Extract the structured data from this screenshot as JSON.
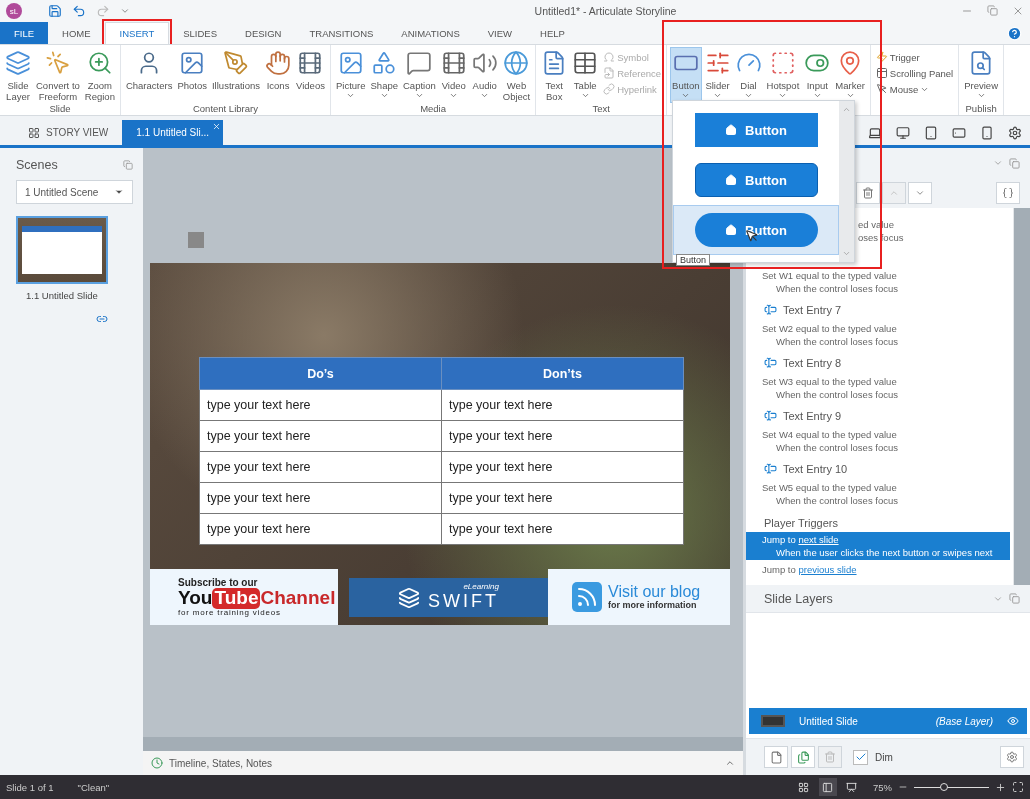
{
  "app": {
    "badge": "sL",
    "title": "Untitled1* - Articulate Storyline"
  },
  "menu_tabs": [
    {
      "label": "FILE",
      "kind": "file",
      "selected": false,
      "highlighted": false
    },
    {
      "label": "HOME",
      "kind": "tab",
      "selected": false,
      "highlighted": false
    },
    {
      "label": "INSERT",
      "kind": "tab",
      "selected": true,
      "highlighted": true
    },
    {
      "label": "SLIDES",
      "kind": "tab",
      "selected": false,
      "highlighted": false
    },
    {
      "label": "DESIGN",
      "kind": "tab",
      "selected": false,
      "highlighted": false
    },
    {
      "label": "TRANSITIONS",
      "kind": "tab",
      "selected": false,
      "highlighted": false
    },
    {
      "label": "ANIMATIONS",
      "kind": "tab",
      "selected": false,
      "highlighted": false
    },
    {
      "label": "VIEW",
      "kind": "tab",
      "selected": false,
      "highlighted": false
    },
    {
      "label": "HELP",
      "kind": "tab",
      "selected": false,
      "highlighted": false
    }
  ],
  "ribbon": [
    {
      "label": "Slide",
      "items": [
        {
          "lines": [
            "Slide",
            "Layer"
          ],
          "kind": "large",
          "dropdown": false,
          "selected": false,
          "disabled": false
        },
        {
          "lines": [
            "Convert to",
            "Freeform"
          ],
          "kind": "large",
          "dropdown": false,
          "selected": false,
          "disabled": false
        },
        {
          "lines": [
            "Zoom",
            "Region"
          ],
          "kind": "large",
          "dropdown": false,
          "selected": false,
          "disabled": false
        }
      ]
    },
    {
      "label": "Content Library",
      "items": [
        {
          "lines": [
            "Characters"
          ],
          "kind": "large",
          "dropdown": false,
          "selected": false,
          "disabled": false
        },
        {
          "lines": [
            "Photos"
          ],
          "kind": "large",
          "dropdown": false,
          "selected": false,
          "disabled": false
        },
        {
          "lines": [
            "Illustrations"
          ],
          "kind": "large",
          "dropdown": false,
          "selected": false,
          "disabled": false
        },
        {
          "lines": [
            "Icons"
          ],
          "kind": "large",
          "dropdown": false,
          "selected": false,
          "disabled": false
        },
        {
          "lines": [
            "Videos"
          ],
          "kind": "large",
          "dropdown": false,
          "selected": false,
          "disabled": false
        }
      ]
    },
    {
      "label": "Media",
      "items": [
        {
          "lines": [
            "Picture"
          ],
          "kind": "large",
          "dropdown": true,
          "selected": false,
          "disabled": false
        },
        {
          "lines": [
            "Shape"
          ],
          "kind": "large",
          "dropdown": true,
          "selected": false,
          "disabled": false
        },
        {
          "lines": [
            "Caption"
          ],
          "kind": "large",
          "dropdown": true,
          "selected": false,
          "disabled": false
        },
        {
          "lines": [
            "Video"
          ],
          "kind": "large",
          "dropdown": true,
          "selected": false,
          "disabled": false
        },
        {
          "lines": [
            "Audio"
          ],
          "kind": "large",
          "dropdown": true,
          "selected": false,
          "disabled": false
        },
        {
          "lines": [
            "Web",
            "Object"
          ],
          "kind": "large",
          "dropdown": false,
          "selected": false,
          "disabled": false
        }
      ]
    },
    {
      "label": "Text",
      "items": [
        {
          "lines": [
            "Text",
            "Box"
          ],
          "kind": "large",
          "dropdown": false,
          "selected": false,
          "disabled": false
        },
        {
          "lines": [
            "Table"
          ],
          "kind": "large",
          "dropdown": true,
          "selected": false,
          "disabled": false
        },
        {
          "lines": [
            "Symbol"
          ],
          "kind": "small",
          "dropdown": false,
          "selected": false,
          "disabled": true
        },
        {
          "lines": [
            "Reference"
          ],
          "kind": "small",
          "dropdown": false,
          "selected": false,
          "disabled": true
        },
        {
          "lines": [
            "Hyperlink"
          ],
          "kind": "small",
          "dropdown": false,
          "selected": false,
          "disabled": true
        }
      ]
    },
    {
      "items": [
        {
          "lines": [
            "Button"
          ],
          "kind": "large",
          "dropdown": true,
          "selected": true,
          "disabled": false
        },
        {
          "lines": [
            "Slider"
          ],
          "kind": "large",
          "dropdown": true,
          "selected": false,
          "disabled": false
        },
        {
          "lines": [
            "Dial"
          ],
          "kind": "large",
          "dropdown": true,
          "selected": false,
          "disabled": false
        },
        {
          "lines": [
            "Hotspot"
          ],
          "kind": "large",
          "dropdown": true,
          "selected": false,
          "disabled": false
        },
        {
          "lines": [
            "Input"
          ],
          "kind": "large",
          "dropdown": true,
          "selected": false,
          "disabled": false
        },
        {
          "lines": [
            "Marker"
          ],
          "kind": "large",
          "dropdown": true,
          "selected": false,
          "disabled": false
        }
      ]
    },
    {
      "items": [
        {
          "lines": [
            "Trigger"
          ],
          "kind": "small",
          "dropdown": false,
          "selected": false,
          "disabled": false
        },
        {
          "lines": [
            "Scrolling Panel"
          ],
          "kind": "small",
          "dropdown": false,
          "selected": false,
          "disabled": false
        },
        {
          "lines": [
            "Mouse"
          ],
          "kind": "small",
          "dropdown": true,
          "selected": false,
          "disabled": false
        }
      ]
    },
    {
      "label": "Publish",
      "items": [
        {
          "lines": [
            "Preview"
          ],
          "kind": "large",
          "dropdown": true,
          "selected": false,
          "disabled": false
        }
      ]
    }
  ],
  "button_gallery": {
    "highlighted": true,
    "tooltip": "Button",
    "items": [
      {
        "label": "Button",
        "kind": "square",
        "selected": false
      },
      {
        "label": "Button",
        "kind": "rounded",
        "selected": false
      },
      {
        "label": "Button",
        "kind": "pill",
        "selected": true
      }
    ]
  },
  "doc_tabs": [
    {
      "label": "STORY VIEW",
      "kind": "story",
      "selected": false
    },
    {
      "label": "1.1 Untitled Sli...",
      "kind": "slide",
      "selected": true
    }
  ],
  "scenes": {
    "title": "Scenes",
    "scene": "1 Untitled Scene",
    "slides": [
      {
        "label": "1.1 Untitled Slide",
        "selected": true
      }
    ]
  },
  "slide": {
    "table": {
      "columns": [
        "Do’s",
        "Don’ts"
      ],
      "rows": [
        [
          "type your text here",
          "type your text here"
        ],
        [
          "type your text here",
          "type your text here"
        ],
        [
          "type your text here",
          "type your text here"
        ],
        [
          "type your text here",
          "type your text here"
        ],
        [
          "type your text here",
          "type your text here"
        ]
      ]
    },
    "banner": {
      "youtube": {
        "kicker": "Subscribe to our",
        "brand_a": "You",
        "brand_b": "Tube",
        "brand_c": "Channel",
        "note": "for more training videos"
      },
      "swift": {
        "small": "eLearning",
        "name": "SWIFT"
      },
      "blog": {
        "title": "Visit our blog",
        "note": "for more information"
      }
    }
  },
  "timeline_label": "Timeline, States, Notes",
  "triggers": {
    "fragment": [
      "ed value",
      "oses focus"
    ],
    "entries": [
      {
        "kind": "action",
        "text": "Set W1 equal to the typed value",
        "condition": "When the control loses focus",
        "selected": false
      },
      {
        "kind": "object",
        "text": "Text Entry 7",
        "selected": false
      },
      {
        "kind": "action",
        "text": "Set W2 equal to the typed value",
        "condition": "When the control loses focus",
        "selected": false
      },
      {
        "kind": "object",
        "text": "Text Entry 8",
        "selected": false
      },
      {
        "kind": "action",
        "text": "Set W3 equal to the typed value",
        "condition": "When the control loses focus",
        "selected": false
      },
      {
        "kind": "object",
        "text": "Text Entry 9",
        "selected": false
      },
      {
        "kind": "action",
        "text": "Set W4 equal to the typed value",
        "condition": "When the control loses focus",
        "selected": false
      },
      {
        "kind": "object",
        "text": "Text Entry 10",
        "selected": false
      },
      {
        "kind": "action",
        "text": "Set W5 equal to the typed value",
        "condition": "When the control loses focus",
        "selected": false
      },
      {
        "kind": "heading",
        "text": "Player Triggers",
        "selected": false
      },
      {
        "kind": "jump",
        "text": "Jump to",
        "link": "next slide",
        "condition": "When the user clicks the next button or swipes next",
        "selected": true
      },
      {
        "kind": "jump",
        "text": "Jump to",
        "link": "previous slide",
        "selected": false
      }
    ]
  },
  "layers": {
    "title": "Slide Layers",
    "items": [
      {
        "name": "Untitled Slide",
        "tag": "(Base Layer)",
        "selected": true,
        "visible": true
      }
    ],
    "dim": {
      "label": "Dim",
      "checked": true
    }
  },
  "status": {
    "slide": "Slide 1 of 1",
    "state": "\"Clean\"",
    "views": [
      {
        "selected": false
      },
      {
        "selected": true
      },
      {
        "selected": false
      }
    ],
    "zoom": {
      "reading": "75%",
      "level": 0.4
    }
  }
}
